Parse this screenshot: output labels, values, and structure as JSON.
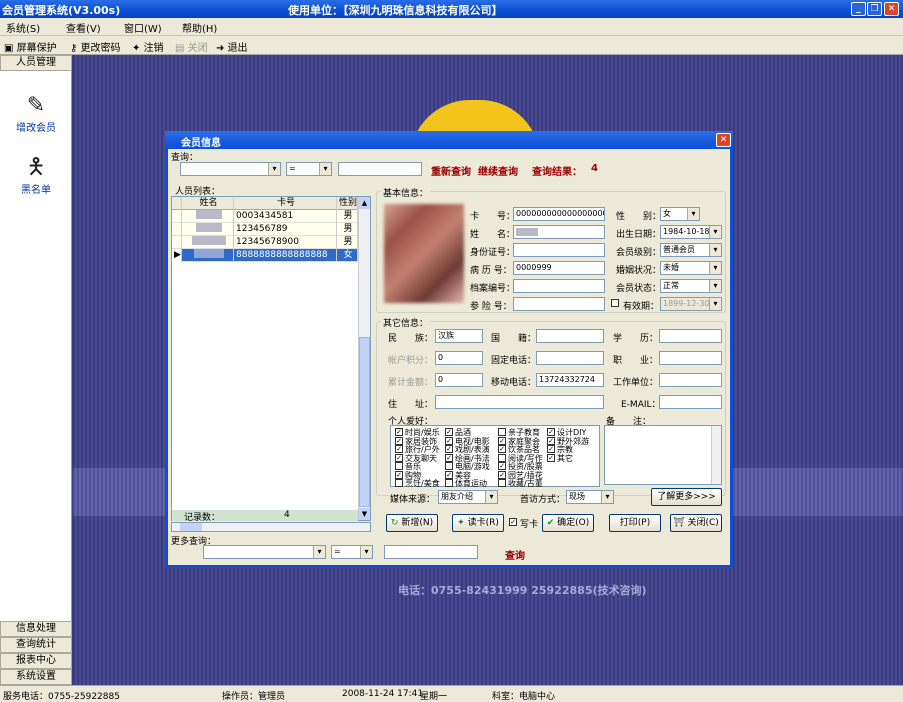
{
  "app": {
    "title": "会员管理系统(V3.00s)",
    "unit": "使用单位：【深圳九明珠信息科技有限公司】"
  },
  "menu": [
    "系统(S)",
    "查看(V)",
    "窗口(W)",
    "帮助(H)"
  ],
  "toolbar": {
    "screensaver": "屏幕保护",
    "change_password": "更改密码",
    "logout": "注销",
    "close": "关闭",
    "exit": "退出"
  },
  "sidebar": {
    "header": "人员管理",
    "items": [
      "增改会员",
      "黑名单"
    ],
    "footer": [
      "信息处理",
      "查询统计",
      "报表中心",
      "系统设置"
    ]
  },
  "desktop": {
    "phone": "电话：0755-82431999 25922885(技术咨询)"
  },
  "status": {
    "service": "服务电话：0755-25922885",
    "operator": "操作员：管理员",
    "datetime": "2008-11-24 17:41",
    "weekday": "星期一",
    "dept": "科室：电脑中心"
  },
  "dialog": {
    "title": "会员信息",
    "query_label": "查询：",
    "query_op": "=",
    "requery": "重新查询",
    "continue_query": "继续查询",
    "result_label": "查询结果：",
    "result_count": "4",
    "list_title": "人员列表：",
    "columns": [
      "姓名",
      "卡号",
      "性别"
    ],
    "rows": [
      {
        "name": "",
        "card": "0003434581",
        "gender": "男"
      },
      {
        "name": "",
        "card": "123456789",
        "gender": "男"
      },
      {
        "name": "",
        "card": "12345678900",
        "gender": "男"
      },
      {
        "name": "",
        "card": "8888888888888888",
        "gender": "女"
      }
    ],
    "record_label": "记录数：",
    "record_count": "4",
    "more_query": "更多查询：",
    "more_op": "=",
    "query_btn": "查询",
    "basic_title": "基本信息：",
    "basic": {
      "card_label": "卡　　号：",
      "card": "0000000000000000000",
      "name_label": "姓　　名：",
      "name": "",
      "id_label": "身份证号：",
      "id": "",
      "record_label": "病 历 号：",
      "record": "0000999",
      "archive_label": "档案编号：",
      "archive": "",
      "insurance_label": "参 险 号：",
      "insurance": "",
      "gender_label": "性　　别：",
      "gender": "女",
      "birth_label": "出生日期：",
      "birth": "1984-10-18",
      "level_label": "会员级别：",
      "level": "普通会员",
      "marital_label": "婚姻状况：",
      "marital": "未婚",
      "state_label": "会员状态：",
      "state": "正常",
      "valid_label": "有效期：",
      "valid": "1899-12-30"
    },
    "other_title": "其它信息：",
    "other": {
      "nation_label": "民　　族：",
      "nation": "汉族",
      "nationality_label": "国　　籍：",
      "nationality": "",
      "education_label": "学　　历：",
      "education": "",
      "points_label": "帐户积分：",
      "points": "0",
      "tel_label": "固定电话：",
      "tel": "",
      "job_label": "职　　业：",
      "job": "",
      "amount_label": "累计金额：",
      "amount": "0",
      "mobile_label": "移动电话：",
      "mobile": "13724332724",
      "work_label": "工作单位：",
      "work": "",
      "address_label": "住　　址：",
      "address": "",
      "email_label": "E-MAIL：",
      "email": "",
      "hobby_label": "个人爱好：",
      "remark_label": "备　　注："
    },
    "hobbies": [
      {
        "label": "时尚/娱乐",
        "checked": true
      },
      {
        "label": "家居装饰",
        "checked": true
      },
      {
        "label": "旅行/户外",
        "checked": true
      },
      {
        "label": "交友聊天",
        "checked": true
      },
      {
        "label": "音乐",
        "checked": false
      },
      {
        "label": "购物",
        "checked": true
      },
      {
        "label": "烹饪/美食",
        "checked": false
      },
      {
        "label": "品酒",
        "checked": true
      },
      {
        "label": "电视/电影",
        "checked": true
      },
      {
        "label": "戏剧/表演",
        "checked": true
      },
      {
        "label": "绘画/书法",
        "checked": true
      },
      {
        "label": "电脑/游戏",
        "checked": false
      },
      {
        "label": "美容",
        "checked": true
      },
      {
        "label": "体育运动",
        "checked": false
      },
      {
        "label": "亲子教育",
        "checked": false
      },
      {
        "label": "家庭聚会",
        "checked": true
      },
      {
        "label": "饮茶品茗",
        "checked": true
      },
      {
        "label": "阅读/写作",
        "checked": false
      },
      {
        "label": "投资/股票",
        "checked": true
      },
      {
        "label": "园艺/插花",
        "checked": true
      },
      {
        "label": "收藏/古董",
        "checked": false
      },
      {
        "label": "设计DIY",
        "checked": true
      },
      {
        "label": "野外郊游",
        "checked": true
      },
      {
        "label": "宗教",
        "checked": true
      },
      {
        "label": "其它",
        "checked": true
      }
    ],
    "source_label": "媒体来源：",
    "source": "朋友介绍",
    "visit_label": "首访方式：",
    "visit": "现场",
    "more_btn": "了解更多>>>",
    "buttons": {
      "add": "新增(N)",
      "read": "读卡(R)",
      "write": "写卡",
      "ok": "确定(O)",
      "print": "打印(P)",
      "close": "关闭(C)"
    }
  }
}
